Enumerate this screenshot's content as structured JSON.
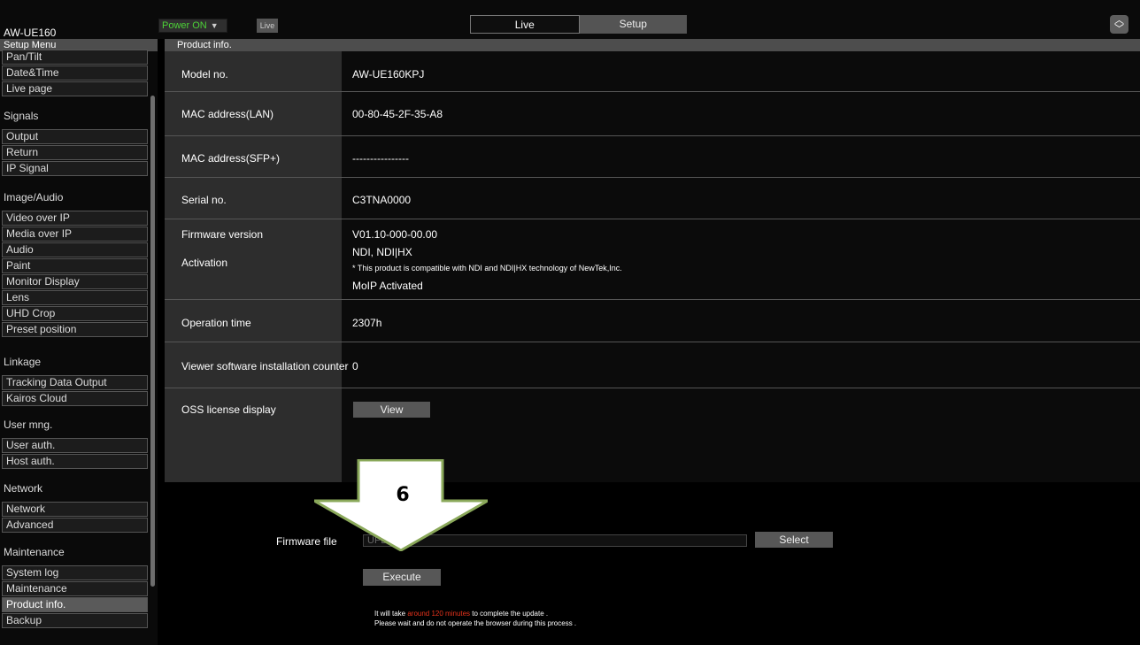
{
  "header": {
    "model_name": "AW-UE160",
    "power_label": "Power ON",
    "live_badge": "Live",
    "tabs": [
      {
        "label": "Live"
      },
      {
        "label": "Setup"
      }
    ],
    "scroll_icon": "up-down-chevron-icon"
  },
  "sidebar": {
    "title": "Setup Menu",
    "items_top": [
      {
        "label": "Pan/Tilt"
      },
      {
        "label": "Date&Time"
      },
      {
        "label": "Live page"
      }
    ],
    "sections": [
      {
        "title": "Signals",
        "items": [
          {
            "label": "Output"
          },
          {
            "label": "Return"
          },
          {
            "label": "IP Signal"
          }
        ]
      },
      {
        "title": "Image/Audio",
        "items": [
          {
            "label": "Video over IP"
          },
          {
            "label": "Media over IP"
          },
          {
            "label": "Audio"
          },
          {
            "label": "Paint"
          },
          {
            "label": "Monitor Display"
          },
          {
            "label": "Lens"
          },
          {
            "label": "UHD Crop"
          },
          {
            "label": "Preset position"
          }
        ]
      },
      {
        "title": "Linkage",
        "items": [
          {
            "label": "Tracking Data Output"
          },
          {
            "label": "Kairos Cloud"
          }
        ]
      },
      {
        "title": "User mng.",
        "items": [
          {
            "label": "User auth."
          },
          {
            "label": "Host auth."
          }
        ]
      },
      {
        "title": "Network",
        "items": [
          {
            "label": "Network"
          },
          {
            "label": "Advanced"
          }
        ]
      },
      {
        "title": "Maintenance",
        "items": [
          {
            "label": "System log"
          },
          {
            "label": "Maintenance"
          },
          {
            "label": "Product info."
          },
          {
            "label": "Backup"
          }
        ]
      }
    ],
    "selected": "Product info."
  },
  "content": {
    "title": "Product info.",
    "rows": [
      {
        "label": "Model no.",
        "value": "AW-UE160KPJ"
      },
      {
        "label": "MAC address(LAN)",
        "value": "00-80-45-2F-35-A8"
      },
      {
        "label": "MAC address(SFP+)",
        "value": "----------------"
      },
      {
        "label": "Serial no.",
        "value": "C3TNA0000"
      },
      {
        "label": "Firmware version",
        "value": "V01.10-000-00.00"
      },
      {
        "label": "Activation",
        "value": "NDI, NDI|HX",
        "note": "* This product is compatible with NDI and NDI|HX technology of NewTek,Inc.",
        "extra": "MoIP Activated"
      },
      {
        "label": "Operation time",
        "value": "2307h"
      },
      {
        "label": "Viewer software installation counter",
        "value": "0"
      },
      {
        "label": "OSS license display",
        "button": "View"
      }
    ]
  },
  "firmware": {
    "label": "Firmware file",
    "input_value": "UPD.....bin",
    "select_label": "Select",
    "execute_label": "Execute",
    "note_prefix": "It will take ",
    "note_highlight": "around 120 minutes",
    "note_suffix": " to complete the update .",
    "note_line2": "Please wait and do not operate the browser during this process ."
  },
  "annotation": {
    "number": "6",
    "color": "#8aa85a"
  }
}
